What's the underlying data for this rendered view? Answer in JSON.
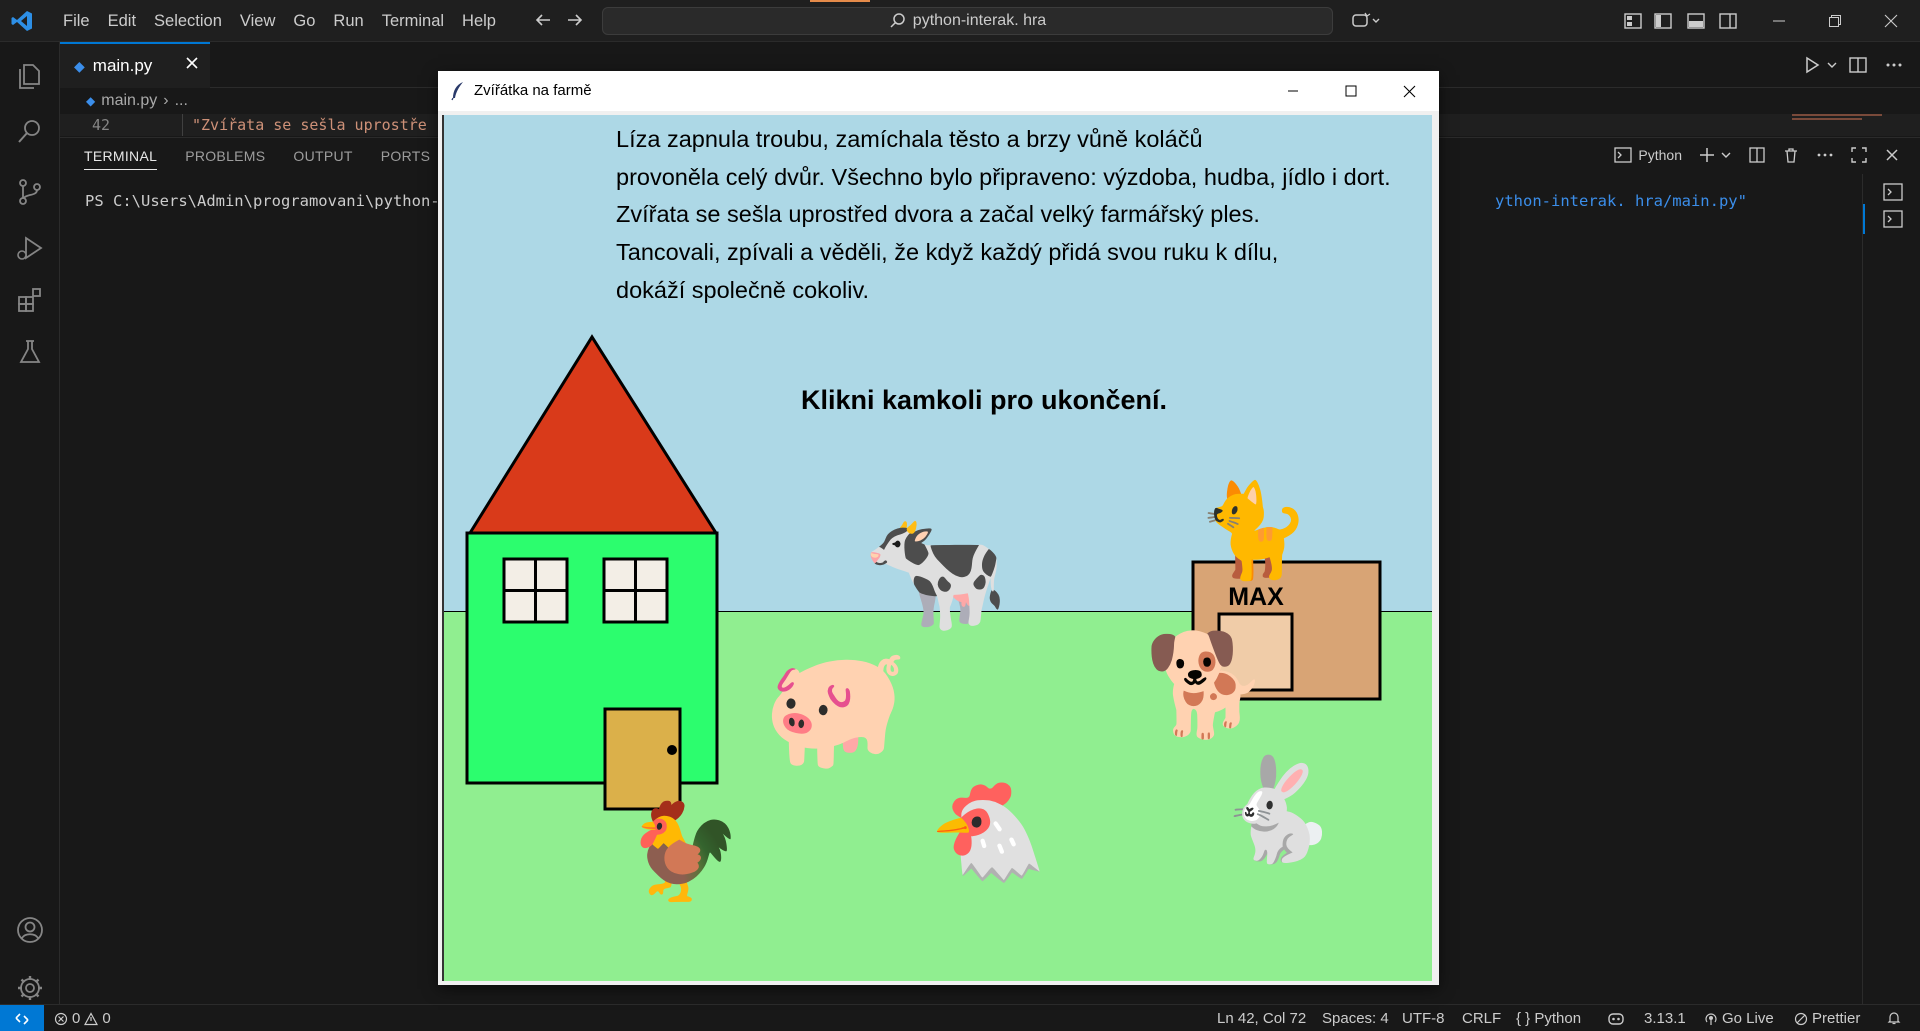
{
  "app": {
    "menu": [
      "File",
      "Edit",
      "Selection",
      "View",
      "Go",
      "Run",
      "Terminal",
      "Help"
    ],
    "search": "python-interak. hra"
  },
  "editor": {
    "tab": "main.py",
    "breadcrumb": [
      "main.py",
      "..."
    ],
    "line_number": "42",
    "line_text": "\"Zvířata se sešla uprostře"
  },
  "panel": {
    "tabs": [
      "TERMINAL",
      "PROBLEMS",
      "OUTPUT",
      "PORTS"
    ],
    "active_tab": "TERMINAL",
    "terminal_profile": "Python",
    "terminal_prompt": "PS C:\\Users\\Admin\\programovani\\python-i",
    "terminal_tail": "ython-interak. hra/main.py\""
  },
  "statusbar": {
    "errors": "0",
    "warnings": "0",
    "position": "Ln 42, Col 72",
    "spaces": "Spaces: 4",
    "encoding": "UTF-8",
    "eol": "CRLF",
    "language": "Python",
    "python_version": "3.13.1",
    "go_live": "Go Live",
    "prettier": "Prettier"
  },
  "tk_window": {
    "title": "Zvířátka na farmě",
    "story": [
      "Líza zapnula troubu, zamíchala těsto a brzy vůně koláčů",
      "provoněla celý dvůr. Všechno bylo připraveno: výzdoba, hudba, jídlo i dort.",
      "Zvířata se sešla uprostřed dvora a začal velký farmářský ples.",
      "Tancovali, zpívali a věděli, že když každý přidá svou ruku k dílu,",
      "dokáží společně cokoliv."
    ],
    "instruction": "Klikni kamkoli pro ukončení.",
    "kennel_label": "MAX",
    "animals": [
      "cat-emoji",
      "cow-emoji",
      "pig-emoji",
      "dog-emoji",
      "rooster-emoji",
      "chicken-emoji",
      "rabbit-emoji"
    ],
    "colors": {
      "sky": "#add8e6",
      "grass": "#90ee90",
      "house_wall": "#2cfd6e",
      "roof": "#d93a1a",
      "door": "#dbb04a",
      "kennel": "#d8a475",
      "kennel_door": "#f0cca8"
    }
  }
}
